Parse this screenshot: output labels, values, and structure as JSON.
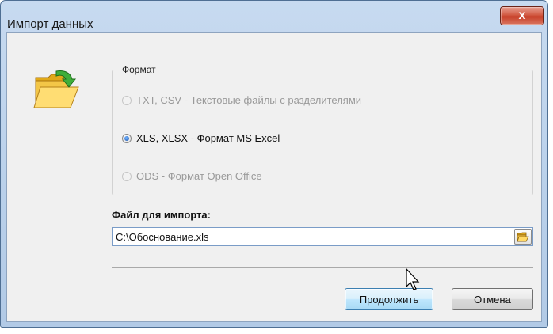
{
  "window": {
    "title": "Импорт данных",
    "close_glyph": "x"
  },
  "format_group": {
    "legend": "Формат",
    "options": [
      {
        "label": "TXT, CSV -  Текстовые файлы с разделителями",
        "checked": false,
        "enabled": false
      },
      {
        "label": "XLS, XLSX - Формат MS Excel",
        "checked": true,
        "enabled": true
      },
      {
        "label": "ODS - Формат Open Office",
        "checked": false,
        "enabled": false
      }
    ]
  },
  "file": {
    "label": "Файл для импорта:",
    "value": "C:\\Обоснование.xls"
  },
  "buttons": {
    "continue": "Продолжить",
    "cancel": "Отмена"
  },
  "icons": {
    "main": "folder-import-icon",
    "browse": "open-folder-icon",
    "cursor": "mouse-pointer-icon"
  },
  "colors": {
    "titlebar": "#b9d0ea",
    "close": "#c7412a",
    "default_button": "#bee6fd"
  }
}
